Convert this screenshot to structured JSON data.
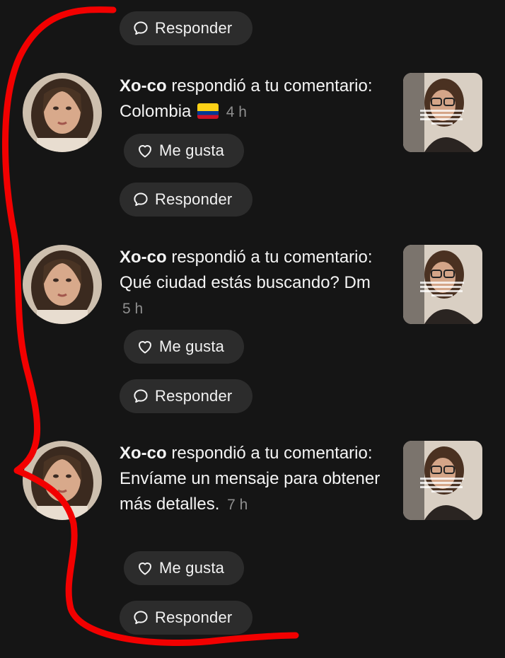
{
  "buttons": {
    "reply_label": "Responder",
    "like_label": "Me gusta"
  },
  "notifications": [
    {
      "user": "Xo-co",
      "action": "respondió a tu comentario:",
      "comment": "Colombia",
      "has_flag": true,
      "time": "4 h"
    },
    {
      "user": "Xo-co",
      "action": "respondió a tu comentario:",
      "comment": "Qué ciudad estás buscando? Dm",
      "time": "5 h"
    },
    {
      "user": "Xo-co",
      "action": "respondió a tu comentario:",
      "comment": "Envíame un mensaje para obtener más detalles.",
      "time": "7 h"
    }
  ],
  "colors": {
    "background": "#151515",
    "pill": "#2c2c2c",
    "annotation": "#f20000",
    "timestamp": "#8e8e8e"
  }
}
